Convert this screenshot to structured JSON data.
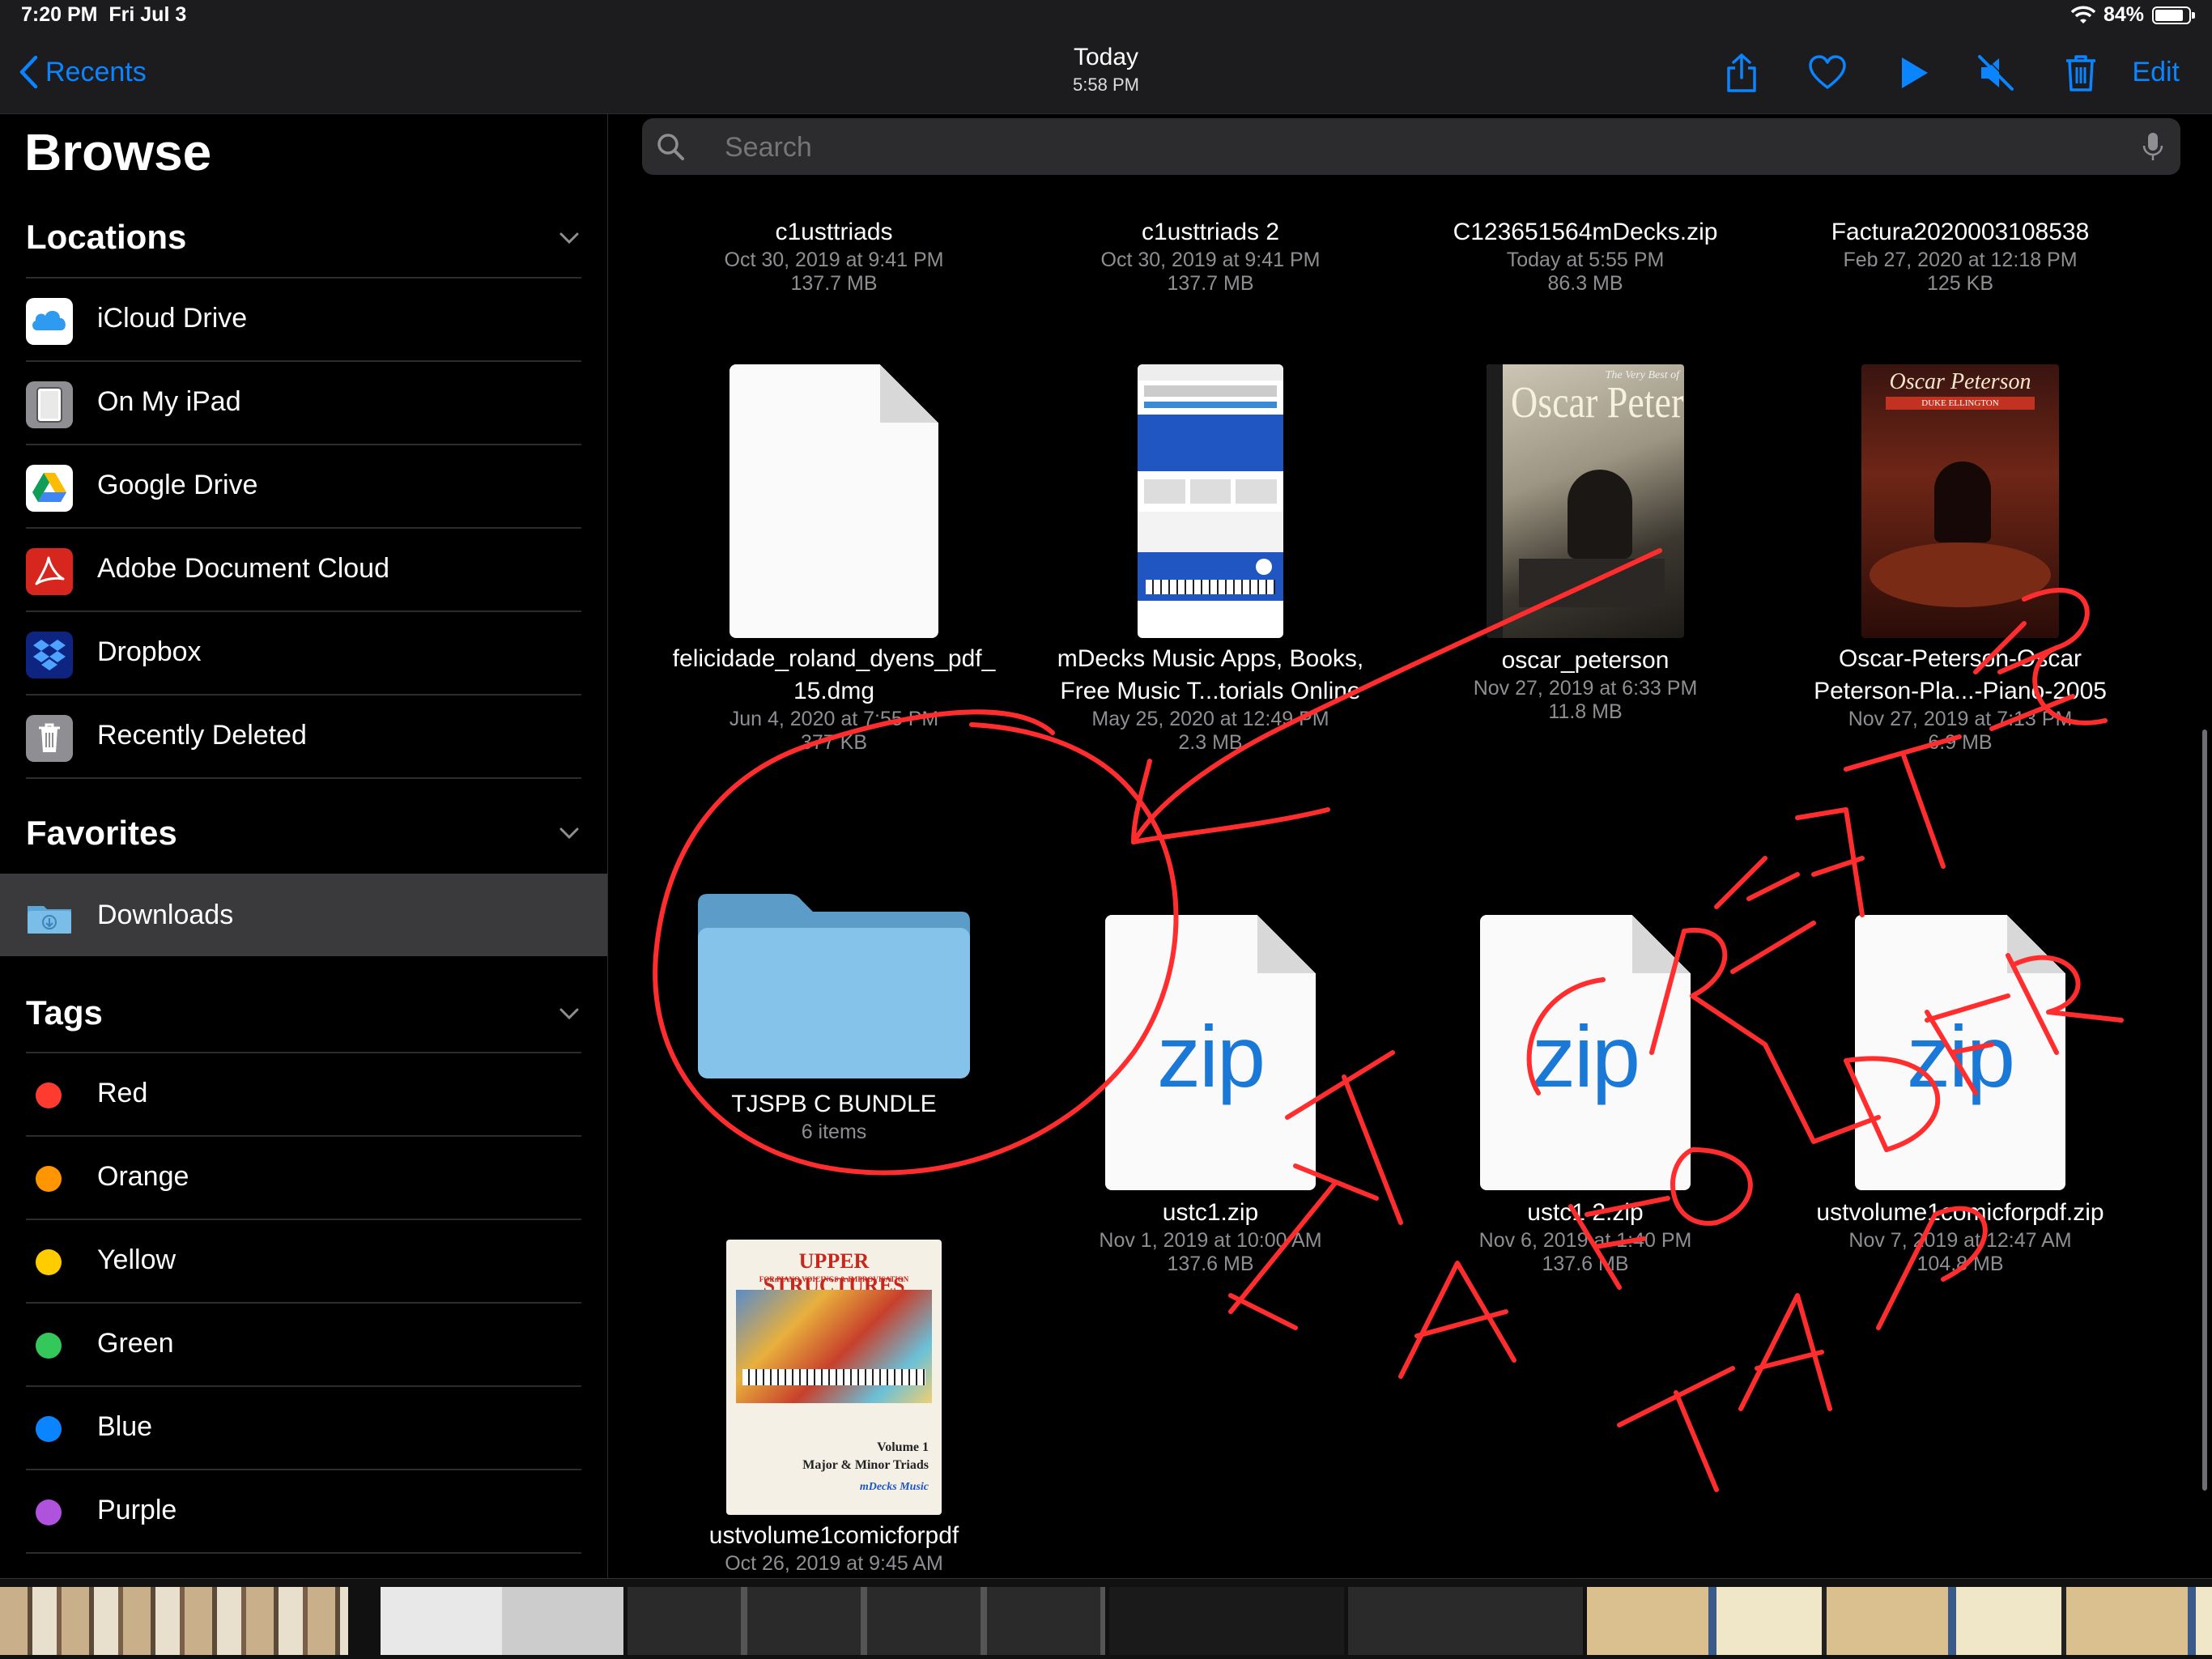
{
  "status_bar": {
    "time": "7:20 PM",
    "date": "Fri Jul 3",
    "battery": "84%",
    "battery_level": 0.84
  },
  "nav": {
    "back_label": "Recents",
    "title": "Today",
    "subtitle": "5:58 PM",
    "edit_label": "Edit",
    "icons": [
      "share-icon",
      "heart-icon",
      "play-icon",
      "mute-icon",
      "trash-icon"
    ],
    "accent": "#0a84ff"
  },
  "sidebar": {
    "title": "Browse",
    "locations": {
      "heading": "Locations",
      "items": [
        {
          "label": "iCloud Drive",
          "icon": "icloud-icon"
        },
        {
          "label": "On My iPad",
          "icon": "ipad-icon"
        },
        {
          "label": "Google Drive",
          "icon": "google-drive-icon"
        },
        {
          "label": "Adobe Document Cloud",
          "icon": "adobe-icon"
        },
        {
          "label": "Dropbox",
          "icon": "dropbox-icon"
        },
        {
          "label": "Recently Deleted",
          "icon": "trash-icon"
        }
      ]
    },
    "favorites": {
      "heading": "Favorites",
      "items": [
        {
          "label": "Downloads",
          "icon": "downloads-folder-icon",
          "selected": true
        }
      ]
    },
    "tags": {
      "heading": "Tags",
      "items": [
        {
          "label": "Red",
          "color": "#ff3b30"
        },
        {
          "label": "Orange",
          "color": "#ff9500"
        },
        {
          "label": "Yellow",
          "color": "#ffcc00"
        },
        {
          "label": "Green",
          "color": "#34c759"
        },
        {
          "label": "Blue",
          "color": "#0a84ff"
        },
        {
          "label": "Purple",
          "color": "#af52de"
        }
      ]
    }
  },
  "search": {
    "placeholder": "Search"
  },
  "files": [
    {
      "name": "c1usttriads",
      "date": "Oct 30, 2019 at 9:41 PM",
      "size": "137.7 MB"
    },
    {
      "name": "c1usttriads 2",
      "date": "Oct 30, 2019 at 9:41 PM",
      "size": "137.7 MB"
    },
    {
      "name": "C123651564mDecks.zip",
      "date": "Today at 5:55 PM",
      "size": "86.3 MB"
    },
    {
      "name": "Factura2020003108538",
      "date": "Feb 27, 2020 at 12:18 PM",
      "size": "125 KB"
    },
    {
      "name": "felicidade_roland_dyens_pdf_\n15.dmg",
      "date": "Jun 4, 2020 at 7:55 PM",
      "size": "377 KB",
      "kind": "blank document"
    },
    {
      "name": "mDecks Music Apps, Books,\nFree Music T...torials Online",
      "date": "May 25, 2020 at 12:49 PM",
      "size": "2.3 MB",
      "kind": "web page thumbnail"
    },
    {
      "name": "oscar_peterson",
      "date": "Nov 27, 2019 at 6:33 PM",
      "size": "11.8 MB",
      "kind": "book cover",
      "cover_text": "Oscar Peterson",
      "cover_subtitle": "The Very Best of"
    },
    {
      "name": "Oscar-Peterson-Oscar\nPeterson-Pla...-Piano-2005",
      "date": "Nov 27, 2019 at 7:13 PM",
      "size": "6.9 MB",
      "kind": "book cover",
      "cover_text": "Oscar Peterson",
      "cover_subtitle": "DUKE ELLINGTON"
    },
    {
      "name": "TJSPB C BUNDLE",
      "date": "6 items",
      "size": "",
      "kind": "folder"
    },
    {
      "name": "ustc1.zip",
      "date": "Nov 1, 2019 at 10:00 AM",
      "size": "137.6 MB",
      "kind": "zip",
      "icon_text": "zip"
    },
    {
      "name": "ustc1 2.zip",
      "date": "Nov 6, 2019 at 1:40 PM",
      "size": "137.6 MB",
      "kind": "zip",
      "icon_text": "zip"
    },
    {
      "name": "ustvolume1comicforpdf.zip",
      "date": "Nov 7, 2019 at 12:47 AM",
      "size": "104.8 MB",
      "kind": "zip",
      "icon_text": "zip"
    },
    {
      "name": "ustvolume1comicforpdf",
      "date": "Oct 26, 2019 at 9:45 AM",
      "size": "",
      "kind": "book cover",
      "cover_text": "UPPER STRUCTURES",
      "cover_subtitle": "FOR PIANO VOICINGS & IMPROVISATION",
      "cover_volume": "Volume 1",
      "cover_volume_sub": "Major & Minor Triads",
      "cover_brand": "mDecks Music"
    }
  ],
  "annotation": {
    "text": "IT CREATES A FOLDER TAP",
    "color": "#ff2d2d"
  }
}
